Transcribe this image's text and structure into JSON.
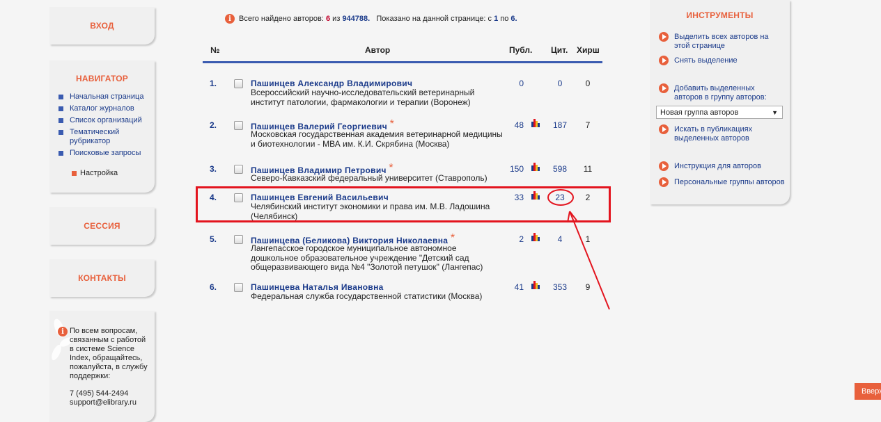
{
  "left": {
    "login_label": "ВХОД",
    "navigator_title": "НАВИГАТОР",
    "nav_items": [
      "Начальная страница",
      "Каталог журналов",
      "Список организаций",
      "Тематический рубрикатор",
      "Поисковые запросы"
    ],
    "settings_label": "Настройка",
    "session_label": "СЕССИЯ",
    "contacts_label": "КОНТАКТЫ",
    "support_text": "По всем вопросам, связанным с работой в системе Science Index, обращайтесь, пожалуйста, в службу поддержки:",
    "support_phone": "7 (495) 544-2494",
    "support_email": "support@elibrary.ru"
  },
  "summary": {
    "prefix": "Всего найдено авторов:",
    "found": "6",
    "of_word": "из",
    "total": "944788.",
    "shown_prefix": "Показано на данной странице: с",
    "from": "1",
    "to_word": "по",
    "to": "6."
  },
  "table": {
    "headers": {
      "num": "№",
      "author": "Автор",
      "pubs": "Публ.",
      "cit": "Цит.",
      "hirsch": "Хирш"
    },
    "rows": [
      {
        "num": "1.",
        "name": "Пашинцев Александр Владимирович",
        "star": false,
        "org": "Всероссийский научно-исследовательский ветеринарный институт патологии, фармакологии и терапии (Воронеж)",
        "pubs": "0",
        "cit": "0",
        "h": "0",
        "has_chart": false
      },
      {
        "num": "2.",
        "name": "Пашинцев Валерий Георгиевич",
        "star": true,
        "org": "Московская государственная академия ветеринарной медицины и биотехнологии - МВА им. К.И. Скрябина (Москва)",
        "pubs": "48",
        "cit": "187",
        "h": "7",
        "has_chart": true
      },
      {
        "num": "3.",
        "name": "Пашинцев Владимир Петрович",
        "star": true,
        "org": "Северо-Кавказский федеральный университет (Ставрополь)",
        "pubs": "150",
        "cit": "598",
        "h": "11",
        "has_chart": true
      },
      {
        "num": "4.",
        "name": "Пашинцев Евгений Васильевич",
        "star": false,
        "org": "Челябинский институт экономики и права им. М.В. Ладошина (Челябинск)",
        "pubs": "33",
        "cit": "23",
        "h": "2",
        "has_chart": true
      },
      {
        "num": "5.",
        "name": "Пашинцева (Беликова) Виктория Николаевна",
        "star": true,
        "org": "Лангепасское городское муниципальное автономное дошкольное образовательное учреждение \"Детский сад общеразвивающего вида №4 \"Золотой петушок\" (Лангепас)",
        "pubs": "2",
        "cit": "4",
        "h": "1",
        "has_chart": true
      },
      {
        "num": "6.",
        "name": "Пашинцева Наталья Ивановна",
        "star": false,
        "org": "Федеральная служба государственной статистики (Москва)",
        "pubs": "41",
        "cit": "353",
        "h": "9",
        "has_chart": true
      }
    ],
    "star_glyph": "*"
  },
  "tools": {
    "title": "ИНСТРУМЕНТЫ",
    "select_all": "Выделить всех авторов на этой странице",
    "deselect": "Снять выделение",
    "add_to_group": "Добавить выделенных авторов в группу авторов:",
    "group_select_value": "Новая группа авторов",
    "search_pubs": "Искать в публикациях выделенных авторов",
    "instructions": "Инструкция для авторов",
    "personal_groups": "Персональные группы авторов"
  },
  "up_button": "Вверх",
  "colors": {
    "accent": "#e8603c",
    "link": "#1a3a8a",
    "highlight": "#e3141e",
    "rule": "#3a5bb0"
  }
}
